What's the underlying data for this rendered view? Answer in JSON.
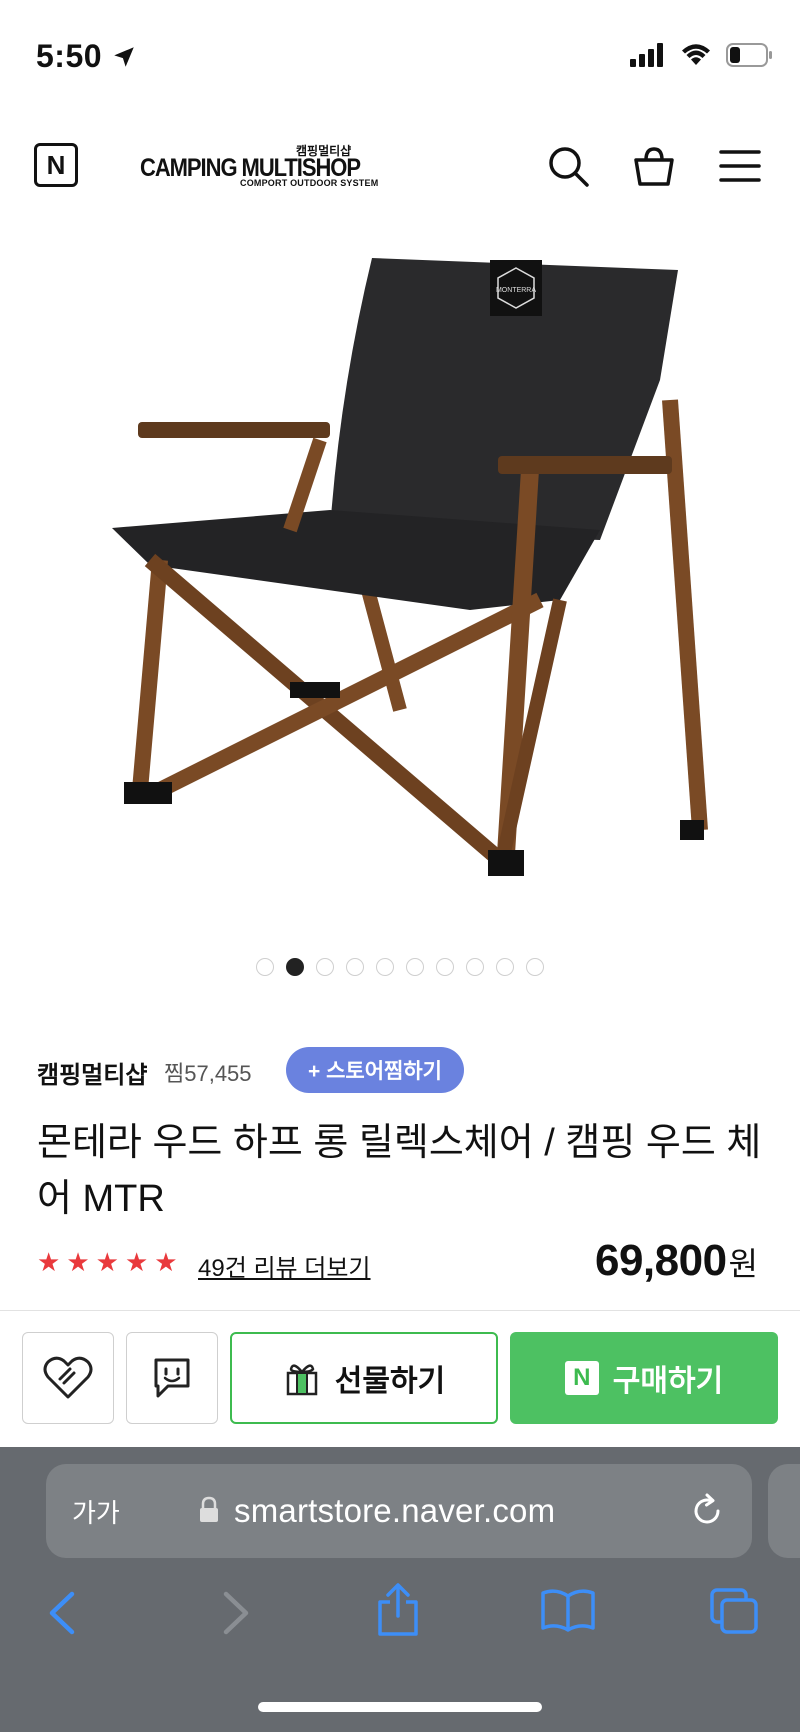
{
  "status": {
    "time": "5:50"
  },
  "header": {
    "menu_n": "N",
    "brand_main": "CAMPING MULTISHOP",
    "brand_korean": "캠핑멀티샵",
    "brand_sub": "COMPORT OUTDOOR SYSTEM"
  },
  "gallery": {
    "image_logo": "MONTERRA",
    "total": 10,
    "active_index": 2
  },
  "store": {
    "name": "캠핑멀티샵",
    "likes": "찜57,455",
    "favorite_button": "+ 스토어찜하기"
  },
  "product": {
    "title": "몬테라 우드 하프 롱 릴렉스체어 / 캠핑 우드 체어 MTR",
    "rating_stars": 5,
    "review_link": "49건 리뷰 더보기",
    "price": "69,800",
    "price_unit": "원"
  },
  "actions": {
    "gift": "선물하기",
    "buy": "구매하기",
    "buy_badge": "N"
  },
  "browser": {
    "text_size": "가가",
    "url": "smartstore.naver.com"
  },
  "colors": {
    "accent_green": "#4dc162",
    "favorite_blue": "#6a82df",
    "star_red": "#e9393c",
    "toolbar": "#666a6f"
  }
}
